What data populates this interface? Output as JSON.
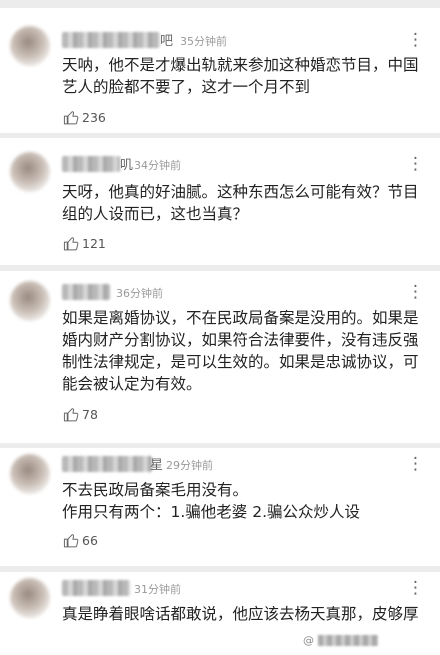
{
  "comments": [
    {
      "name_tail": "吧",
      "time": "35分钟前",
      "text": "天呐，他不是才爆出轨就来参加这种婚恋节目，中国艺人的脸都不要了，这才一个月不到",
      "likes": "236",
      "more": "⋮"
    },
    {
      "name_tail": "叽",
      "time": "34分钟前",
      "text": "天呀，他真的好油腻。这种东西怎么可能有效？节目组的人设而已，这也当真？",
      "likes": "121",
      "more": "⋮"
    },
    {
      "name_tail": "",
      "time": "36分钟前",
      "text": "如果是离婚协议，不在民政局备案是没用的。如果是婚内财产分割协议，如果符合法律要件，没有违反强制性法律规定，是可以生效的。如果是忠诚协议，可能会被认定为有效。",
      "likes": "78",
      "more": "⋮"
    },
    {
      "name_tail": "星",
      "time": "29分钟前",
      "text": "不去民政局备案毛用没有。\n作用只有两个：1.骗他老婆    2.骗公众炒人设",
      "likes": "66",
      "more": "⋮"
    },
    {
      "name_tail": "",
      "time": "31分钟前",
      "text": "真是睁着眼啥话都敢说，他应该去杨天真那，皮够厚",
      "likes": "",
      "more": "⋮"
    }
  ],
  "watermark": {
    "prefix": "@"
  }
}
